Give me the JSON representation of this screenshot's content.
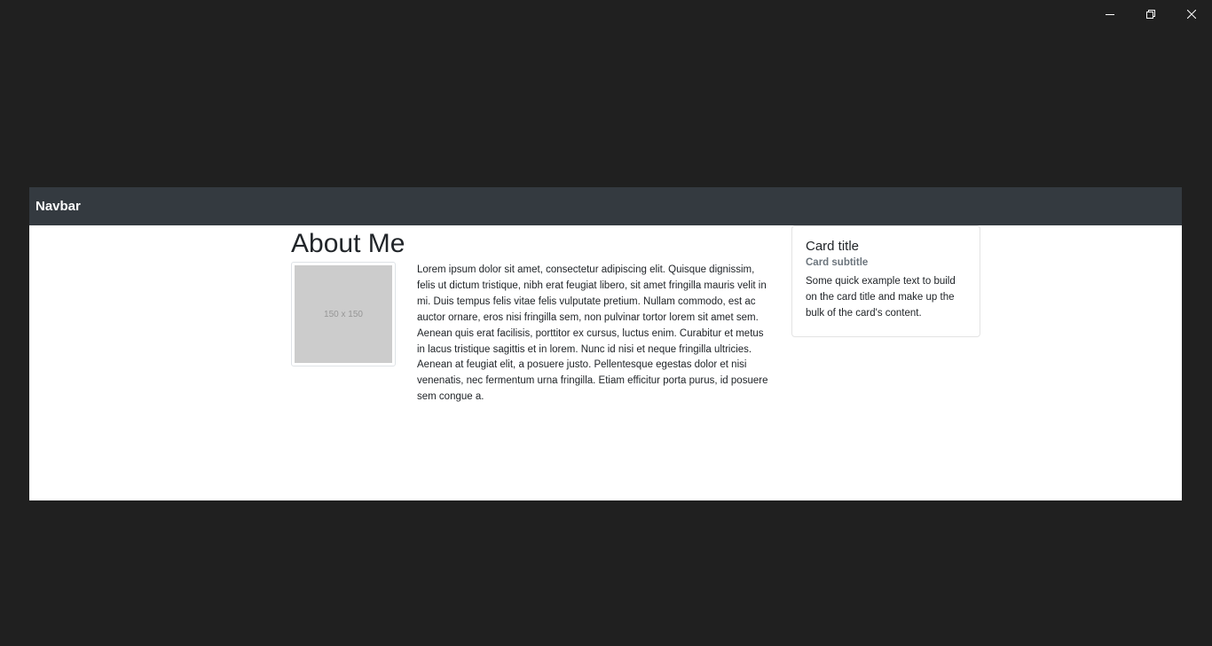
{
  "window": {
    "controls": [
      "minimize",
      "restore",
      "close"
    ]
  },
  "navbar": {
    "brand": "Navbar",
    "background": "#343a40"
  },
  "main": {
    "title": "About Me",
    "image_placeholder": "150 x 150",
    "bio": "Lorem ipsum dolor sit amet, consectetur adipiscing elit. Quisque dignissim, felis ut dictum tristique, nibh erat feugiat libero, sit amet fringilla mauris velit in mi. Duis tempus felis vitae felis vulputate pretium. Nullam commodo, est ac auctor ornare, eros nisi fringilla sem, non pulvinar tortor lorem sit amet sem. Aenean quis erat facilisis, porttitor ex cursus, luctus enim. Curabitur et metus in lacus tristique sagittis et in lorem. Nunc id nisi et neque fringilla ultricies. Aenean at feugiat elit, a posuere justo. Pellentesque egestas dolor et nisi venenatis, nec fermentum urna fringilla. Etiam efficitur porta purus, id posuere sem congue a."
  },
  "card": {
    "title": "Card title",
    "subtitle": "Card subtitle",
    "text": "Some quick example text to build on the card title and make up the bulk of the card's content."
  }
}
